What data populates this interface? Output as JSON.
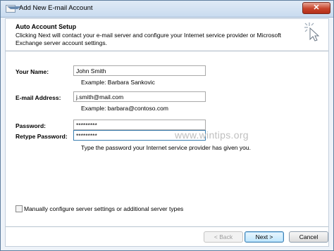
{
  "window": {
    "title": "Add New E-mail Account",
    "close_symbol": "✕"
  },
  "header": {
    "title": "Auto Account Setup",
    "description": "Clicking Next will contact your e-mail server and configure your Internet service provider or Microsoft Exchange server account settings.",
    "icon": "cursor-sparkle-icon"
  },
  "form": {
    "name_label": "Your Name:",
    "name_value": "John Smith",
    "name_example": "Example: Barbara Sankovic",
    "email_label": "E-mail Address:",
    "email_value": "j.smith@mail.com",
    "email_example": "Example: barbara@contoso.com",
    "password_label": "Password:",
    "password_value": "*********",
    "retype_label": "Retype Password:",
    "retype_value": "*********",
    "password_hint": "Type the password your Internet service provider has given you."
  },
  "watermark": "www.wintips.org",
  "manual": {
    "label": "Manually configure server settings or additional server types",
    "checked": false
  },
  "buttons": {
    "back": "< Back",
    "next": "Next >",
    "cancel": "Cancel"
  }
}
